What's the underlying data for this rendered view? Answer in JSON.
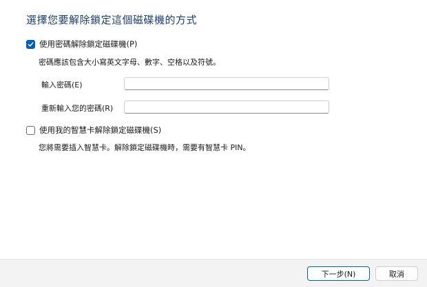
{
  "title": "選擇您要解除鎖定這個磁碟機的方式",
  "password_option": {
    "checked": true,
    "label": "使用密碼解除鎖定磁碟機(P)",
    "description": "密碼應該包含大小寫英文字母、數字、空格以及符號。",
    "enter_label": "輸入密碼(E)",
    "enter_value": "",
    "reenter_label": "重新輸入您的密碼(R)",
    "reenter_value": ""
  },
  "smartcard_option": {
    "checked": false,
    "label": "使用我的智慧卡解除鎖定磁碟機(S)",
    "description": "您將需要插入智慧卡。解除鎖定磁碟機時，需要有智慧卡 PIN。"
  },
  "footer": {
    "next_label": "下一步(N)",
    "cancel_label": "取消"
  },
  "colors": {
    "title": "#1c3d6e",
    "accent": "#005fb8",
    "footer_bg": "#f3f3f3"
  }
}
